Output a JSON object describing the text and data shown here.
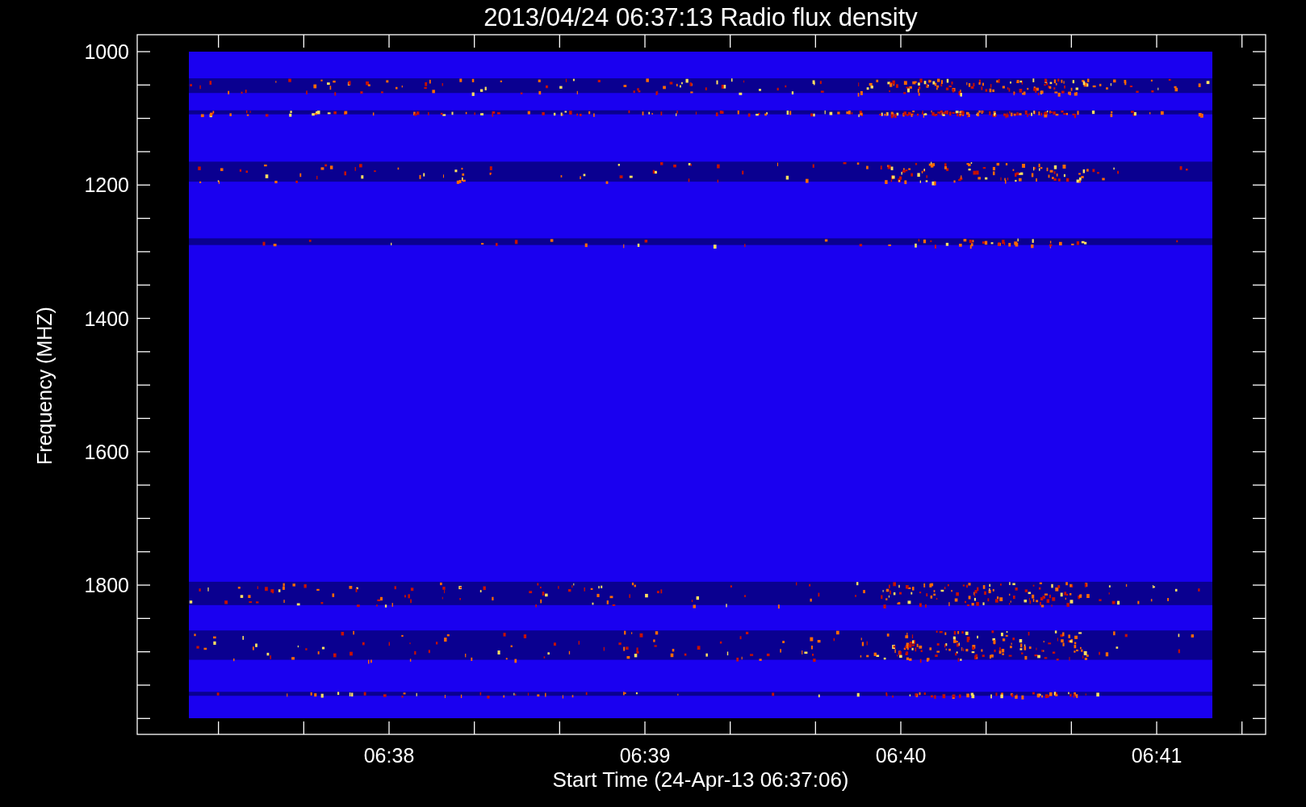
{
  "plot": {
    "title": "2013/04/24 06:37:13 Radio flux density",
    "ylabel": "Frequency (MHZ)",
    "xlabel": "Start Time (24-Apr-13 06:37:06)",
    "y_tick_labels": [
      "1000",
      "1200",
      "1400",
      "1600",
      "1800"
    ],
    "x_tick_labels": [
      "06:38",
      "06:39",
      "06:40",
      "06:41"
    ]
  }
}
